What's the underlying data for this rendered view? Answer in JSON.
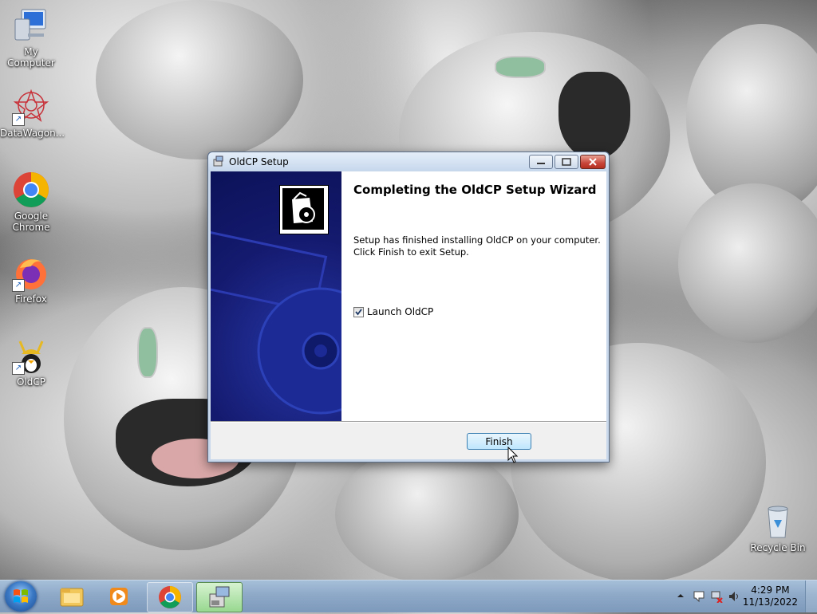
{
  "desktop": {
    "icons": [
      {
        "label": "My Computer",
        "icon": "computer-icon"
      },
      {
        "label": "DataWagon...",
        "icon": "datawagon-icon"
      },
      {
        "label": "Google Chrome",
        "icon": "chrome-icon"
      },
      {
        "label": "Firefox",
        "icon": "firefox-icon"
      },
      {
        "label": "OldCP",
        "icon": "oldcp-icon"
      },
      {
        "label": "Recycle Bin",
        "icon": "recycle-bin-icon"
      }
    ]
  },
  "dialog": {
    "title": "OldCP Setup",
    "heading": "Completing the OldCP Setup Wizard",
    "body_line1": "Setup has finished installing OldCP on your computer.",
    "body_line2": "Click Finish to exit Setup.",
    "checkbox_label": "Launch OldCP",
    "checkbox_checked": true,
    "finish_label": "Finish"
  },
  "taskbar": {
    "pinned": [
      "file-explorer-icon",
      "media-player-icon",
      "chrome-icon",
      "setup-icon"
    ],
    "time": "4:29 PM",
    "date": "11/13/2022"
  }
}
